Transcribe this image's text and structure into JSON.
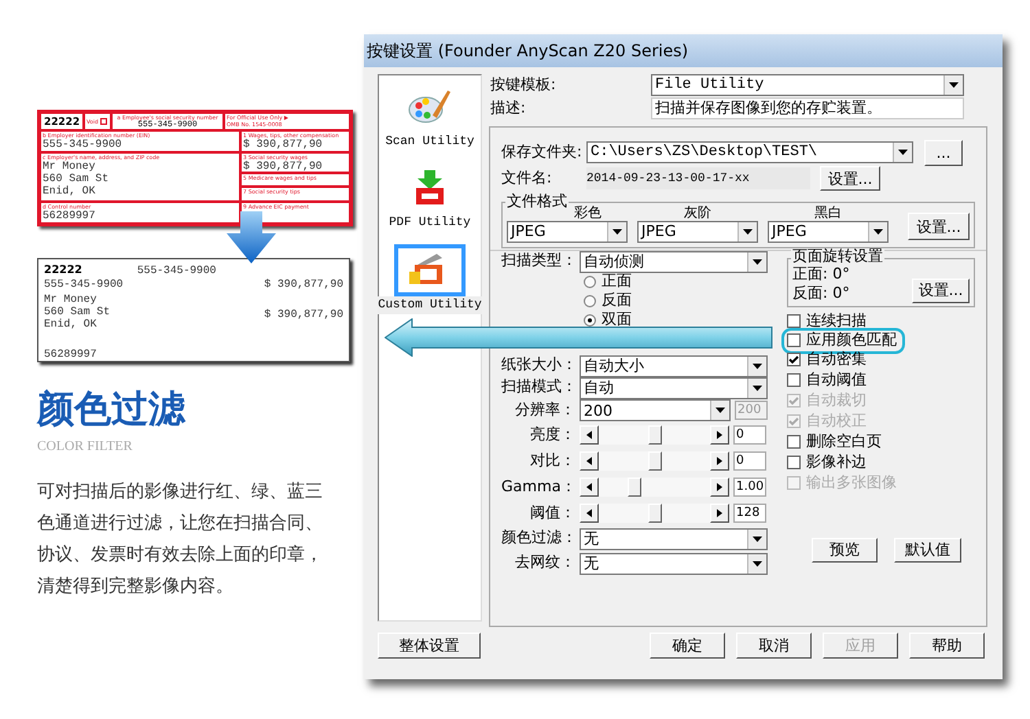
{
  "promo": {
    "title": "颜色过滤",
    "subtitle": "COLOR FILTER",
    "description": "可对扫描后的影像进行红、绿、蓝三色通道进行过滤，让您在扫描合同、协议、发票时有效去除上面的印章，清楚得到完整影像内容。"
  },
  "form_before": {
    "code": "22222",
    "void": "Void",
    "ssn_label": "a Employee's social security number",
    "ssn": "555-345-9900",
    "official": "For Official Use Only ▶",
    "omb": "OMB No. 1545-0008",
    "ein_label": "b Employer identification number (EIN)",
    "ein": "555-345-9900",
    "wages_label": "1 Wages, tips, other compensation",
    "wages": "$ 390,877,90",
    "name_label": "c Employer's name, address, and ZIP code",
    "address": [
      "Mr Money",
      "560 Sam St",
      "Enid, OK"
    ],
    "ss_wages_label": "3 Social security wages",
    "ss_wages": "$ 390,877,90",
    "medicare_label": "5 Medicare wages and tips",
    "tips_label": "7 Social security tips",
    "control_label": "d Control number",
    "control": "56289997",
    "eic_label": "9 Advance EIC payment"
  },
  "form_after": {
    "code": "22222",
    "ssn": "555-345-9900",
    "ein": "555-345-9900",
    "wages": "$ 390,877,90",
    "address": [
      "Mr Money",
      "560 Sam St",
      "Enid, OK"
    ],
    "ss_wages": "$ 390,877,90",
    "control": "56289997"
  },
  "dialog": {
    "title": "按键设置 (Founder AnyScan Z20 Series)",
    "utilities": [
      {
        "kind": "palette",
        "label": "Scan Utility",
        "selected": false
      },
      {
        "kind": "pdf",
        "label": "PDF Utility",
        "selected": false
      },
      {
        "kind": "custom",
        "label": "Custom Utility",
        "selected": true
      }
    ],
    "template": {
      "label": "按键模板:",
      "value": "File Utility"
    },
    "description": {
      "label": "描述:",
      "value": "扫描并保存图像到您的存贮装置。"
    },
    "save_folder": {
      "label": "保存文件夹:",
      "value": "C:\\Users\\ZS\\Desktop\\TEST\\",
      "browse": "..."
    },
    "file_name": {
      "label": "文件名:",
      "value": "2014-09-23-13-00-17-xx",
      "button": "设置..."
    },
    "file_format": {
      "title": "文件格式",
      "columns": [
        {
          "label": "彩色",
          "value": "JPEG"
        },
        {
          "label": "灰阶",
          "value": "JPEG"
        },
        {
          "label": "黑白",
          "value": "JPEG"
        }
      ],
      "button": "设置..."
    },
    "scan_type": {
      "label": "扫描类型：",
      "value": "自动侦测"
    },
    "sides": [
      {
        "label": "正面",
        "selected": false
      },
      {
        "label": "反面",
        "selected": false
      },
      {
        "label": "双面",
        "selected": true
      }
    ],
    "combos": [
      {
        "label": "纸张大小：",
        "value": "自动大小"
      },
      {
        "label": "扫描模式：",
        "value": "自动"
      }
    ],
    "resolution": {
      "label": "分辨率：",
      "value": "200",
      "reading": "200"
    },
    "sliders": [
      {
        "label": "亮度：",
        "level": 0.5,
        "reading": "0"
      },
      {
        "label": "对比：",
        "level": 0.5,
        "reading": "0"
      },
      {
        "label": "Gamma：",
        "level": 0.3,
        "reading": "1.00"
      },
      {
        "label": "阈值：",
        "level": 0.5,
        "reading": "128"
      }
    ],
    "filters": [
      {
        "label": "颜色过滤：",
        "value": "无"
      },
      {
        "label": "去网纹：",
        "value": "无"
      }
    ],
    "rotation": {
      "title": "页面旋转设置",
      "front": "正面: 0°",
      "back": "反面: 0°",
      "button": "设置..."
    },
    "options": [
      {
        "label": "连续扫描",
        "checked": false,
        "disabled": false,
        "highlighted": false
      },
      {
        "label": "应用颜色匹配",
        "checked": false,
        "disabled": false,
        "highlighted": true
      },
      {
        "label": "自动密集",
        "checked": true,
        "disabled": false,
        "highlighted": false
      },
      {
        "label": "自动阈值",
        "checked": false,
        "disabled": false,
        "highlighted": false
      },
      {
        "label": "自动裁切",
        "checked": true,
        "disabled": true,
        "highlighted": false
      },
      {
        "label": "自动校正",
        "checked": true,
        "disabled": true,
        "highlighted": false
      },
      {
        "label": "删除空白页",
        "checked": false,
        "disabled": false,
        "highlighted": false
      },
      {
        "label": "影像补边",
        "checked": false,
        "disabled": false,
        "highlighted": false
      },
      {
        "label": "输出多张图像",
        "checked": false,
        "disabled": true,
        "highlighted": false
      }
    ],
    "preview": "预览",
    "defaults": "默认值",
    "footer": {
      "global": "整体设置",
      "buttons": [
        {
          "label": "确定",
          "disabled": false
        },
        {
          "label": "取消",
          "disabled": false
        },
        {
          "label": "应用",
          "disabled": true
        },
        {
          "label": "帮助",
          "disabled": false
        }
      ]
    }
  }
}
